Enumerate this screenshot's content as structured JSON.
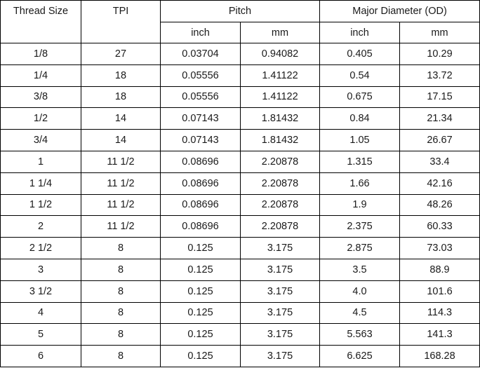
{
  "table": {
    "headers": {
      "thread_size": "Thread Size",
      "tpi": "TPI",
      "pitch": "Pitch",
      "major_diameter": "Major Diameter (OD)",
      "pitch_inch": "inch",
      "pitch_mm": "mm",
      "od_inch": "inch",
      "od_mm": "mm"
    },
    "rows": [
      [
        "1/8",
        "27",
        "0.03704",
        "0.94082",
        "0.405",
        "10.29"
      ],
      [
        "1/4",
        "18",
        "0.05556",
        "1.41122",
        "0.54",
        "13.72"
      ],
      [
        "3/8",
        "18",
        "0.05556",
        "1.41122",
        "0.675",
        "17.15"
      ],
      [
        "1/2",
        "14",
        "0.07143",
        "1.81432",
        "0.84",
        "21.34"
      ],
      [
        "3/4",
        "14",
        "0.07143",
        "1.81432",
        "1.05",
        "26.67"
      ],
      [
        "1",
        "11 1/2",
        "0.08696",
        "2.20878",
        "1.315",
        "33.4"
      ],
      [
        "1 1/4",
        "11 1/2",
        "0.08696",
        "2.20878",
        "1.66",
        "42.16"
      ],
      [
        "1 1/2",
        "11 1/2",
        "0.08696",
        "2.20878",
        "1.9",
        "48.26"
      ],
      [
        "2",
        "11 1/2",
        "0.08696",
        "2.20878",
        "2.375",
        "60.33"
      ],
      [
        "2 1/2",
        "8",
        "0.125",
        "3.175",
        "2.875",
        "73.03"
      ],
      [
        "3",
        "8",
        "0.125",
        "3.175",
        "3.5",
        "88.9"
      ],
      [
        "3 1/2",
        "8",
        "0.125",
        "3.175",
        "4.0",
        "101.6"
      ],
      [
        "4",
        "8",
        "0.125",
        "3.175",
        "4.5",
        "114.3"
      ],
      [
        "5",
        "8",
        "0.125",
        "3.175",
        "5.563",
        "141.3"
      ],
      [
        "6",
        "8",
        "0.125",
        "3.175",
        "6.625",
        "168.28"
      ]
    ]
  }
}
